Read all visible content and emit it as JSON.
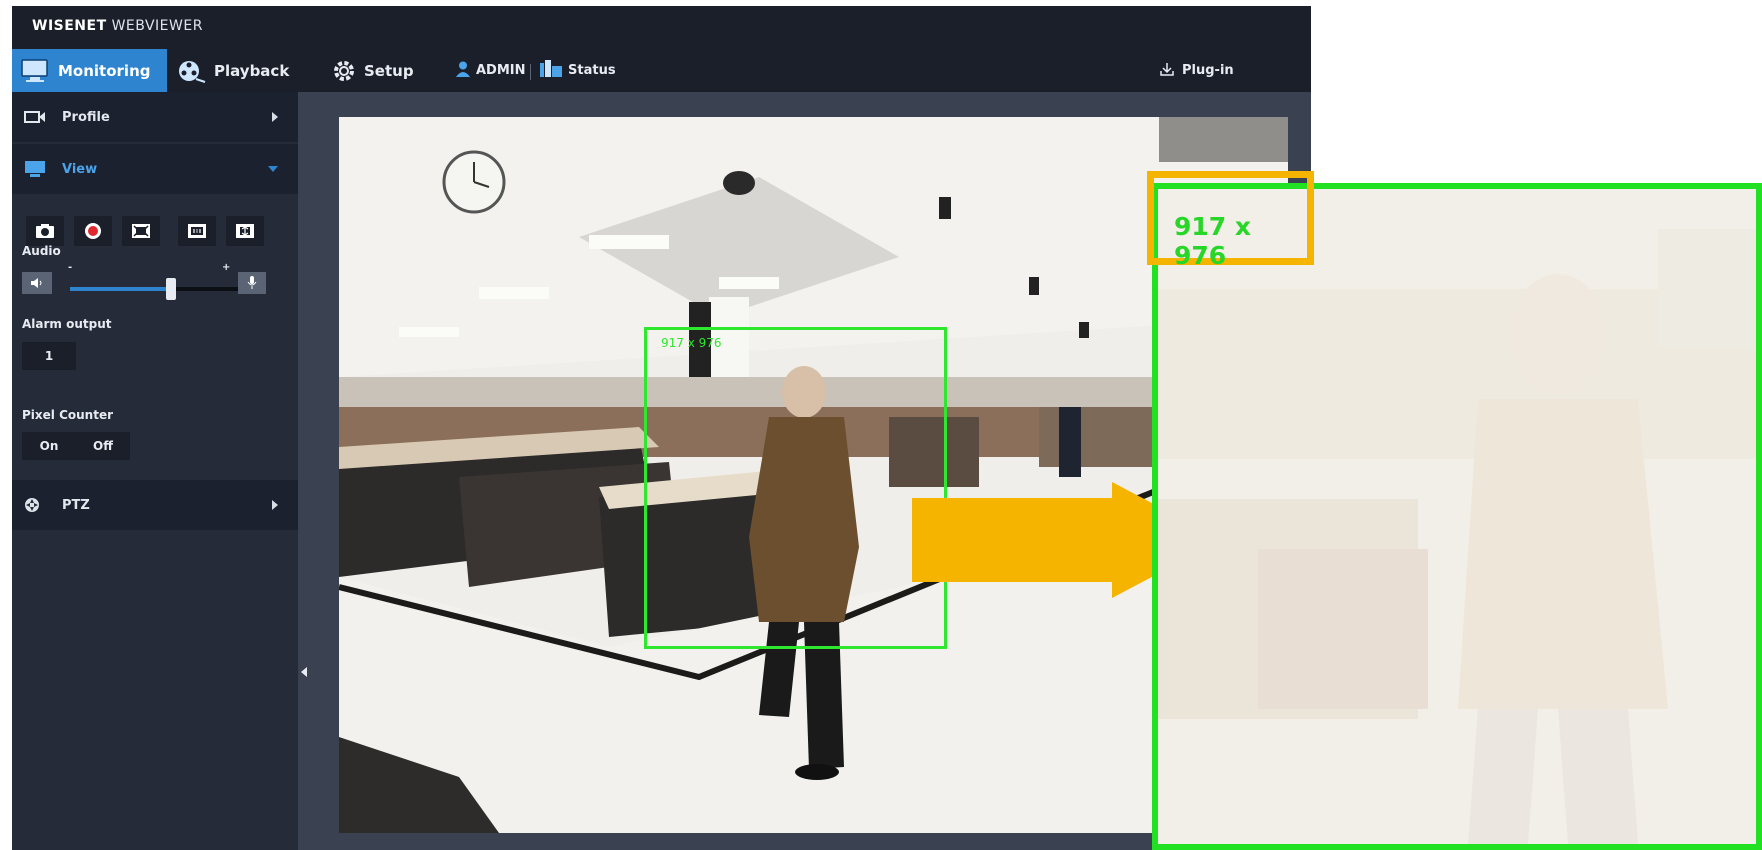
{
  "app": {
    "brand_bold": "WISENET",
    "brand_rest": " WEBVIEWER"
  },
  "nav": {
    "tabs": [
      {
        "label": "Monitoring",
        "icon": "monitor-icon",
        "active": true
      },
      {
        "label": "Playback",
        "icon": "film-reel-icon",
        "active": false
      },
      {
        "label": "Setup",
        "icon": "gear-icon",
        "active": false
      }
    ],
    "user": "ADMIN",
    "status": "Status",
    "plugin": "Plug-in"
  },
  "sidebar": {
    "profile": "Profile",
    "view": "View",
    "audio_label": "Audio",
    "audio_minus": "-",
    "audio_plus": "+",
    "audio_level": 0.6,
    "alarm_label": "Alarm output",
    "alarm_button": "1",
    "pixel_counter_label": "Pixel Counter",
    "pixel_on": "On",
    "pixel_off": "Off",
    "ptz": "PTZ"
  },
  "video": {
    "pixel_box_text": "917 x 976"
  },
  "callout": {
    "label": "917 x 976"
  },
  "colors": {
    "accent": "#2e84cf",
    "pixel_box": "#2ee72e",
    "highlight": "#f4b400"
  }
}
